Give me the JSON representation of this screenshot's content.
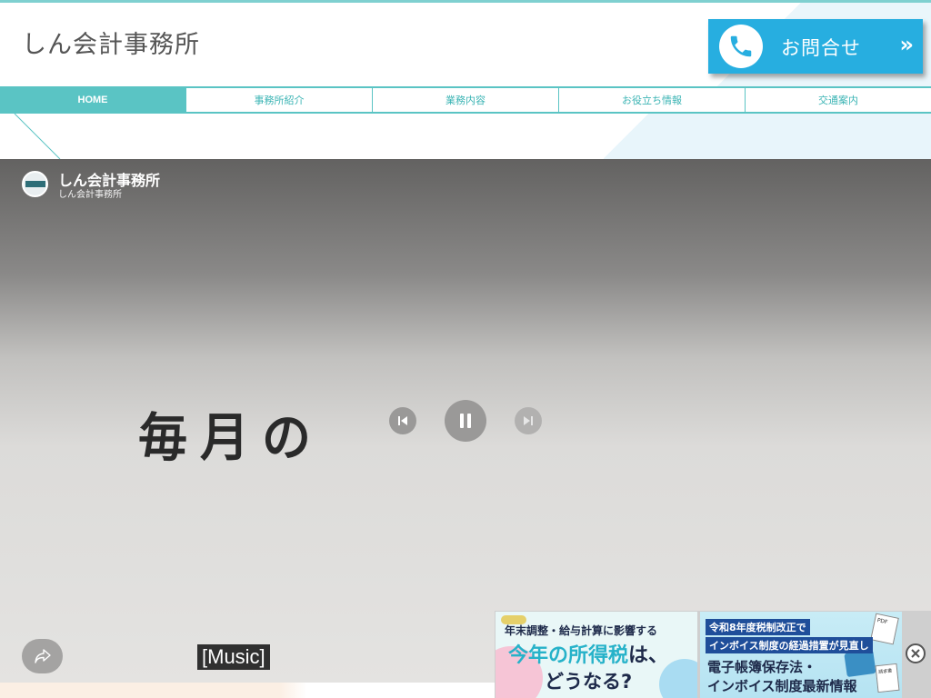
{
  "site": {
    "title": "しん会計事務所"
  },
  "contact_button": {
    "label": "お問合せ",
    "chevron": "»",
    "icon": "phone-icon",
    "color": "#27aee0"
  },
  "nav": {
    "items": [
      {
        "label": "HOME",
        "active": true
      },
      {
        "label": "事務所紹介"
      },
      {
        "label": "業務内容"
      },
      {
        "label": "お役立ち情報"
      },
      {
        "label": "交通案内"
      }
    ],
    "accent": "#5ac4c4"
  },
  "video": {
    "channel_name": "しん会計事務所",
    "channel_sub": "しん会計事務所",
    "overlay_text": "毎月の",
    "caption": "[Music]",
    "controls": [
      "previous-icon",
      "pause-icon",
      "next-icon"
    ],
    "share_icon": "share-icon"
  },
  "ad": {
    "left": {
      "line1": "年末調整・給与計算に影響する",
      "line2_highlight": "今年の所得税",
      "line2_suffix": "は、",
      "line3": "どうなる?"
    },
    "right": {
      "line1": "令和8年度税制改正で",
      "line2": "インボイス制度の経過措置が見直し",
      "line3": "電子帳簿保存法・",
      "line4": "インボイス制度最新情報",
      "doc_tag": "PDF",
      "doc_tag2": "請求書"
    },
    "close_icon": "close-icon"
  }
}
